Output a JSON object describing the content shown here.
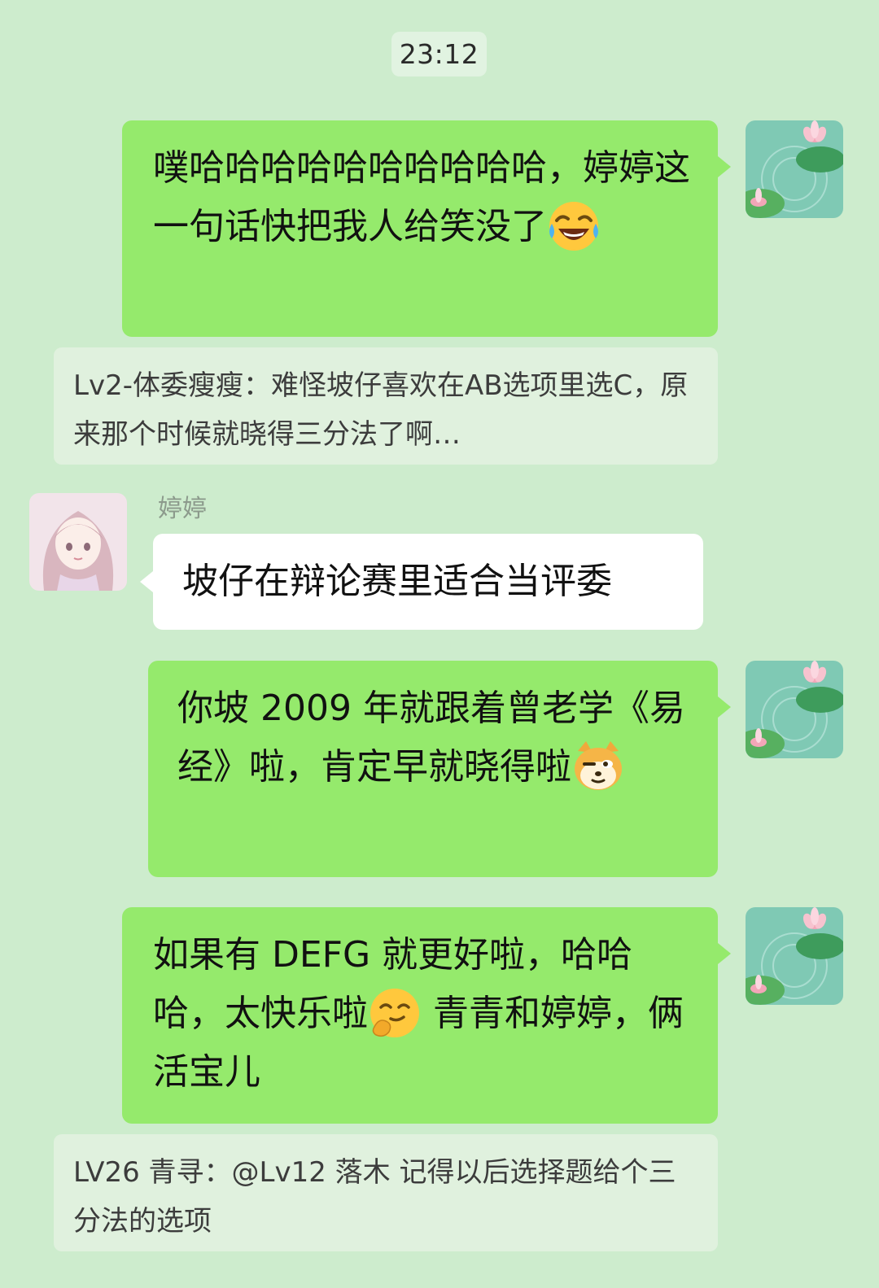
{
  "chat": {
    "timestamp": "23:12",
    "messages": [
      {
        "text": "噗哈哈哈哈哈哈哈哈哈哈，婷婷这一句话快把我人给笑没了",
        "emoji": "tears-of-joy-emoji"
      },
      {
        "quote": "Lv2-体委瘦瘦：难怪坡仔喜欢在AB选项里选C，原来那个时候就晓得三分法了啊…"
      },
      {
        "sender": "婷婷",
        "text": "坡仔在辩论赛里适合当评委"
      },
      {
        "text": "你坡 2009 年就跟着曾老学《易经》啦，肯定早就晓得啦",
        "emoji": "doge-emoji"
      },
      {
        "text_before": "如果有 DEFG 就更好啦，哈哈哈，太快乐啦",
        "emoji": "smirk-emoji",
        "text_after": " 青青和婷婷，俩活宝儿"
      },
      {
        "quote": "LV26 青寻：@Lv12 落木 记得以后选择题给个三分法的选项"
      }
    ]
  },
  "colors": {
    "background": "#cdeccd",
    "sent_bubble": "#95ea6c",
    "received_bubble": "#ffffff",
    "quote_background": "#e0f1de",
    "timestamp_background": "#e1f3e1"
  },
  "avatars": {
    "self": "lotus-pond-avatar",
    "tingting": "anime-girl-avatar"
  }
}
